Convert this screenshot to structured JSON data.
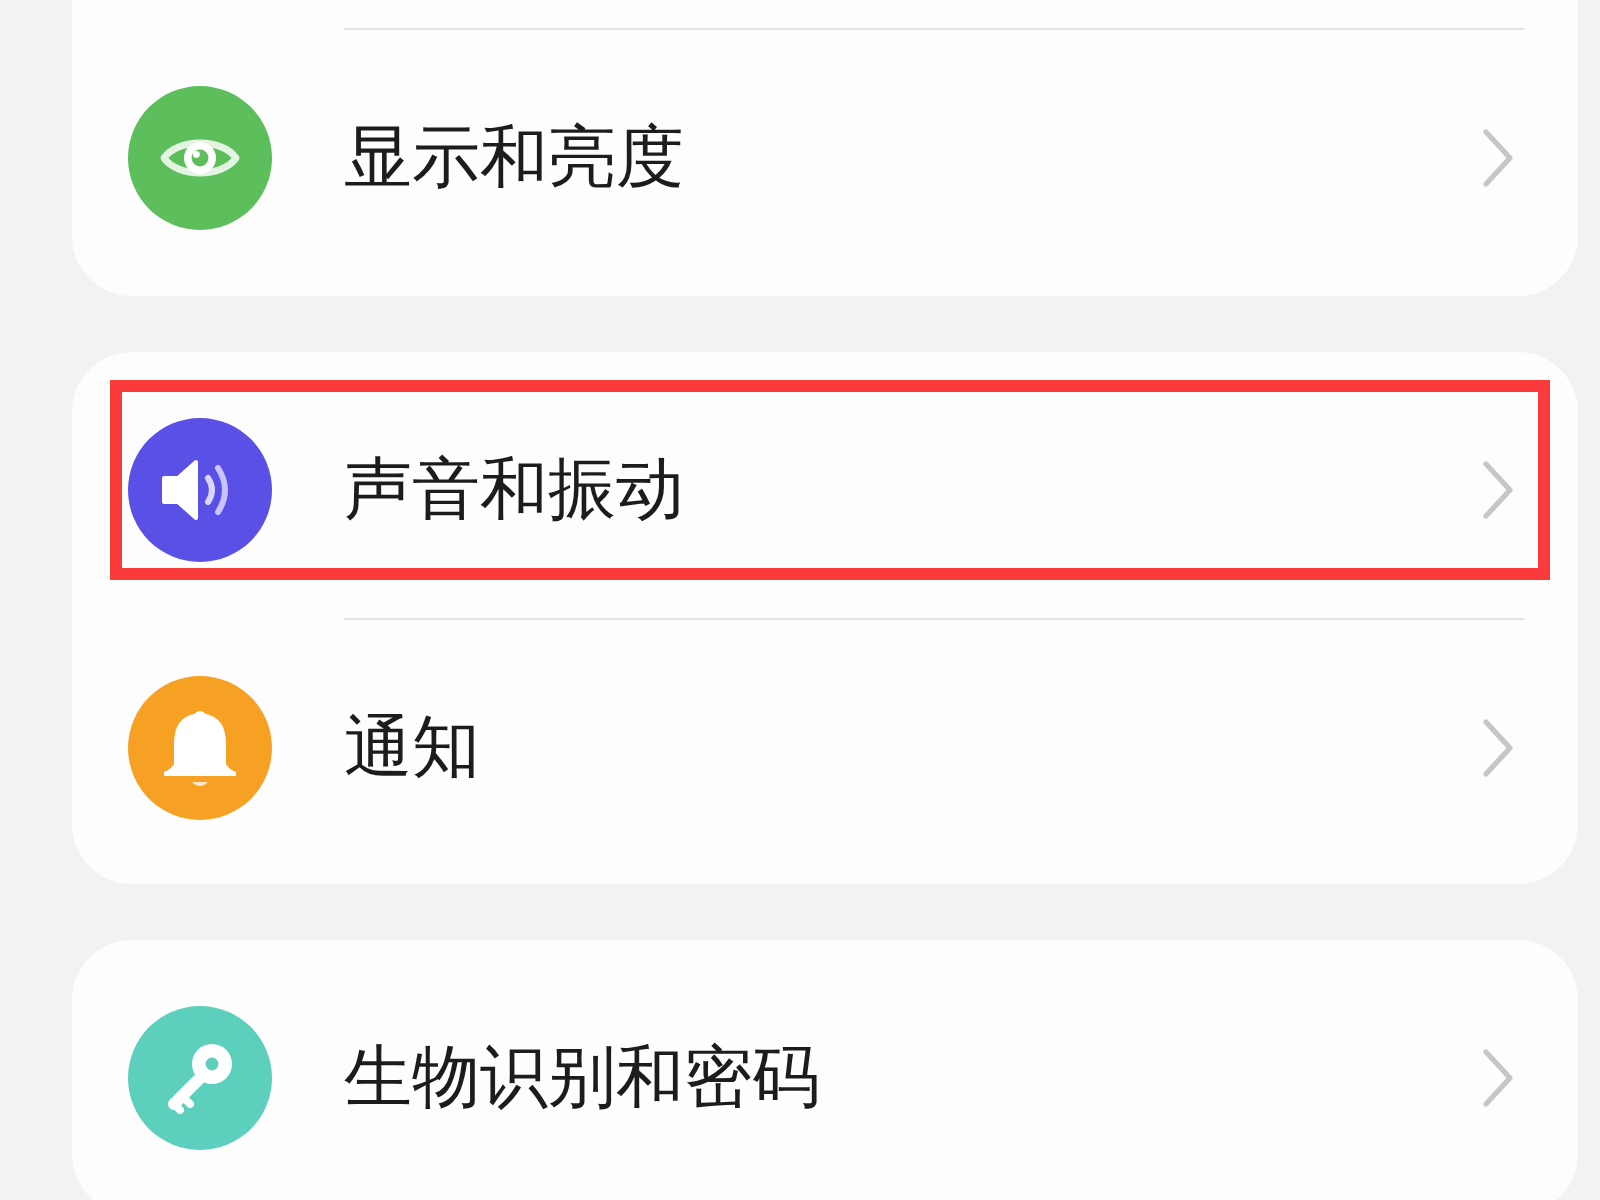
{
  "groups": [
    {
      "items": [
        {
          "label": "显示和亮度",
          "kind": "eye",
          "color": "#5cbf5b",
          "highlighted": false
        }
      ]
    },
    {
      "items": [
        {
          "label": "声音和振动",
          "kind": "speaker",
          "color": "#5a50e6",
          "highlighted": true
        },
        {
          "label": "通知",
          "kind": "bell",
          "color": "#f6a124",
          "highlighted": false
        }
      ]
    },
    {
      "items": [
        {
          "label": "生物识别和密码",
          "kind": "key",
          "color": "#5ccfbd",
          "highlighted": false
        }
      ]
    }
  ]
}
